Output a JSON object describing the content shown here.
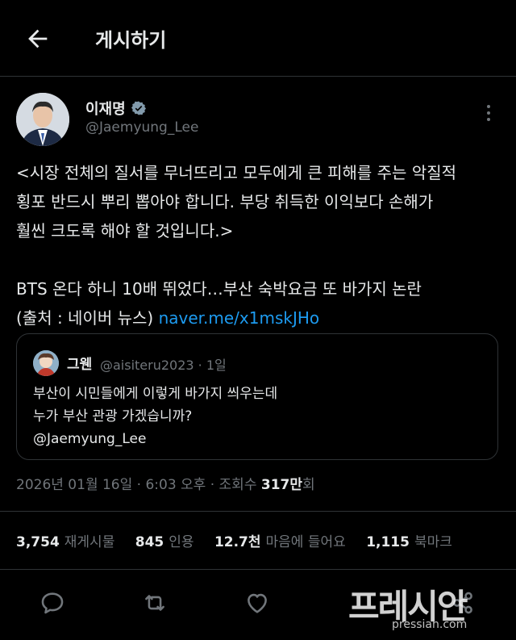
{
  "header": {
    "title": "게시하기"
  },
  "author": {
    "name": "이재명",
    "handle": "@Jaemyung_Lee"
  },
  "post": {
    "lines": [
      "<시장 전체의 질서를 무너뜨리고 모두에게 큰 피해를 주는 악질적",
      "횡포 반드시 뿌리 뽑아야 합니다. 부당 취득한 이익보다 손해가",
      "훨씬 크도록 해야 할 것입니다.>"
    ],
    "headline": "BTS 온다 하니 10배 뛰었다…부산 숙박요금 또 바가지 논란",
    "source_prefix": "(출처 : 네이버 뉴스) ",
    "link": "naver.me/x1mskJHo"
  },
  "quote": {
    "name": "그웬",
    "meta": "@aisiteru2023 · 1일",
    "lines": [
      "부산이 시민들에게 이렇게 바가지 씌우는데",
      "누가 부산 관광 가겠습니까?",
      "@Jaemyung_Lee"
    ]
  },
  "timestamp": {
    "text": "2026년 01월 16일 · 6:03 오후 · 조회수 ",
    "views": "317만",
    "views_suffix": "회"
  },
  "stats": {
    "reposts_count": "3,754",
    "reposts_label": "재게시물",
    "quotes_count": "845",
    "quotes_label": "인용",
    "likes_count": "12.7천",
    "likes_label": "마음에 들어요",
    "bookmarks_count": "1,115",
    "bookmarks_label": "북마크"
  },
  "watermark": {
    "logo": "프레시안",
    "domain": "pressian.com"
  },
  "icons": {
    "back": "arrow-left-icon",
    "verified": "verified-badge-icon",
    "more": "more-vertical-icon",
    "reply": "reply-icon",
    "repost": "repost-icon",
    "like": "heart-icon",
    "share": "share-icon"
  },
  "colors": {
    "background": "#000000",
    "text": "#e7e9ea",
    "muted": "#71767b",
    "link": "#1d9bf0",
    "border": "#2f3336"
  }
}
